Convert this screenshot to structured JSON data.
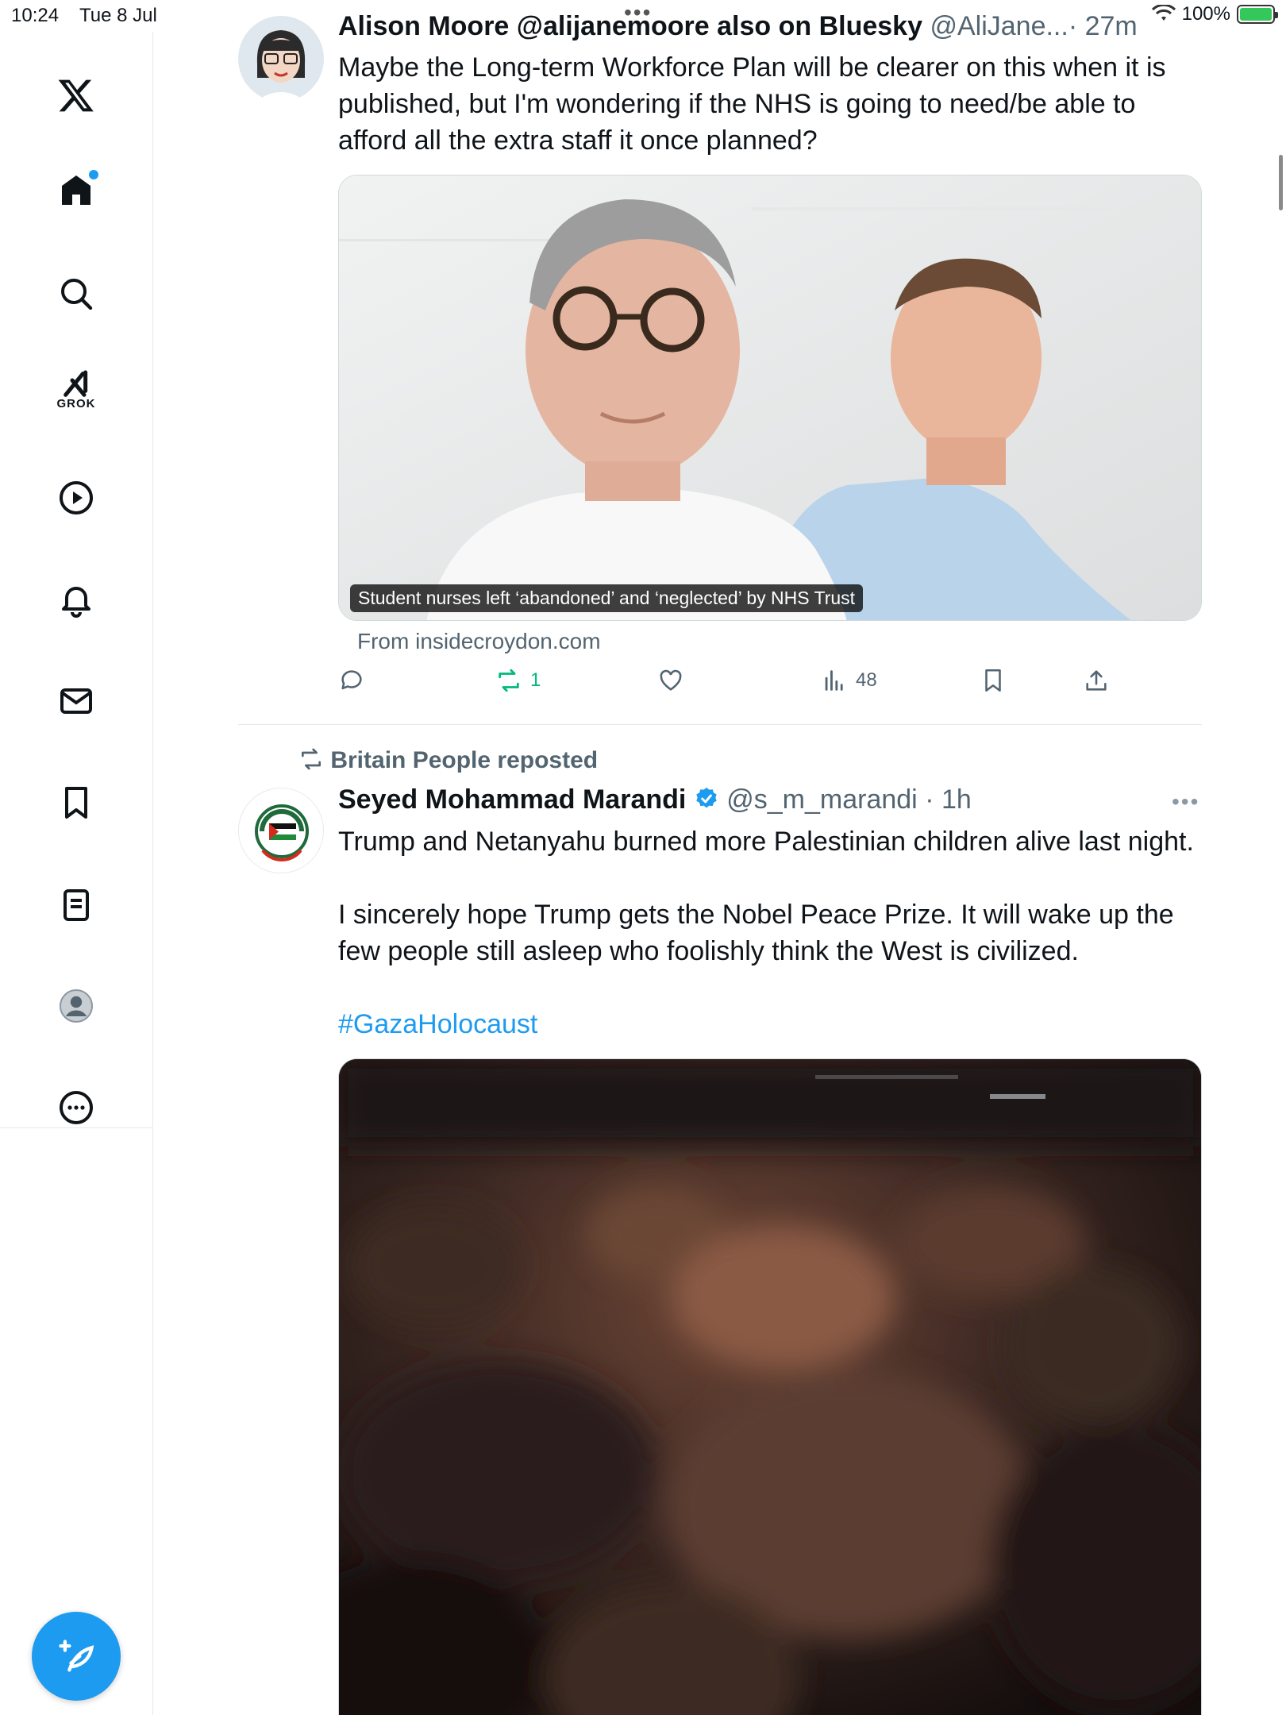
{
  "status_bar": {
    "time": "10:24",
    "date": "Tue 8 Jul",
    "battery": "100%"
  },
  "sidebar": {
    "items": [
      {
        "name": "x-logo",
        "label": ""
      },
      {
        "name": "home",
        "label": "Home"
      },
      {
        "name": "search",
        "label": "Search"
      },
      {
        "name": "grok",
        "label": "GROK"
      },
      {
        "name": "video",
        "label": "Video"
      },
      {
        "name": "notifications",
        "label": "Notifications"
      },
      {
        "name": "messages",
        "label": "Messages"
      },
      {
        "name": "bookmarks",
        "label": "Bookmarks"
      },
      {
        "name": "lists",
        "label": "Lists"
      },
      {
        "name": "profile",
        "label": "Profile"
      },
      {
        "name": "more",
        "label": "More"
      }
    ],
    "grok_label": "GROK"
  },
  "tweets": [
    {
      "display_name": "Alison Moore @alijanemoore also on Bluesky",
      "handle": "@AliJane...",
      "time": "· 27m",
      "text": "Maybe the Long-term Workforce Plan will be clearer on this when it is published, but I'm wondering if the NHS is  going to need/be able to afford all the extra staff it once planned?",
      "media_caption": "Student nurses left ‘abandoned’ and ‘neglected’ by NHS Trust",
      "link_source": "From insidecroydon.com",
      "retweets": "1",
      "views": "48"
    },
    {
      "repost_label": "Britain People reposted",
      "display_name": "Seyed Mohammad Marandi",
      "handle": "@s_m_marandi",
      "time": "· 1h",
      "text_1": "Trump and Netanyahu burned more Palestinian children alive last night.",
      "text_2": "I sincerely hope Trump gets the Nobel Peace Prize. It will wake up the few people still asleep who foolishly think the West is civilized.",
      "hashtag": "#GazaHolocaust"
    }
  ],
  "colors": {
    "accent": "#1d9bf0",
    "retweet_active": "#00ba7c",
    "muted_text": "#536471"
  }
}
